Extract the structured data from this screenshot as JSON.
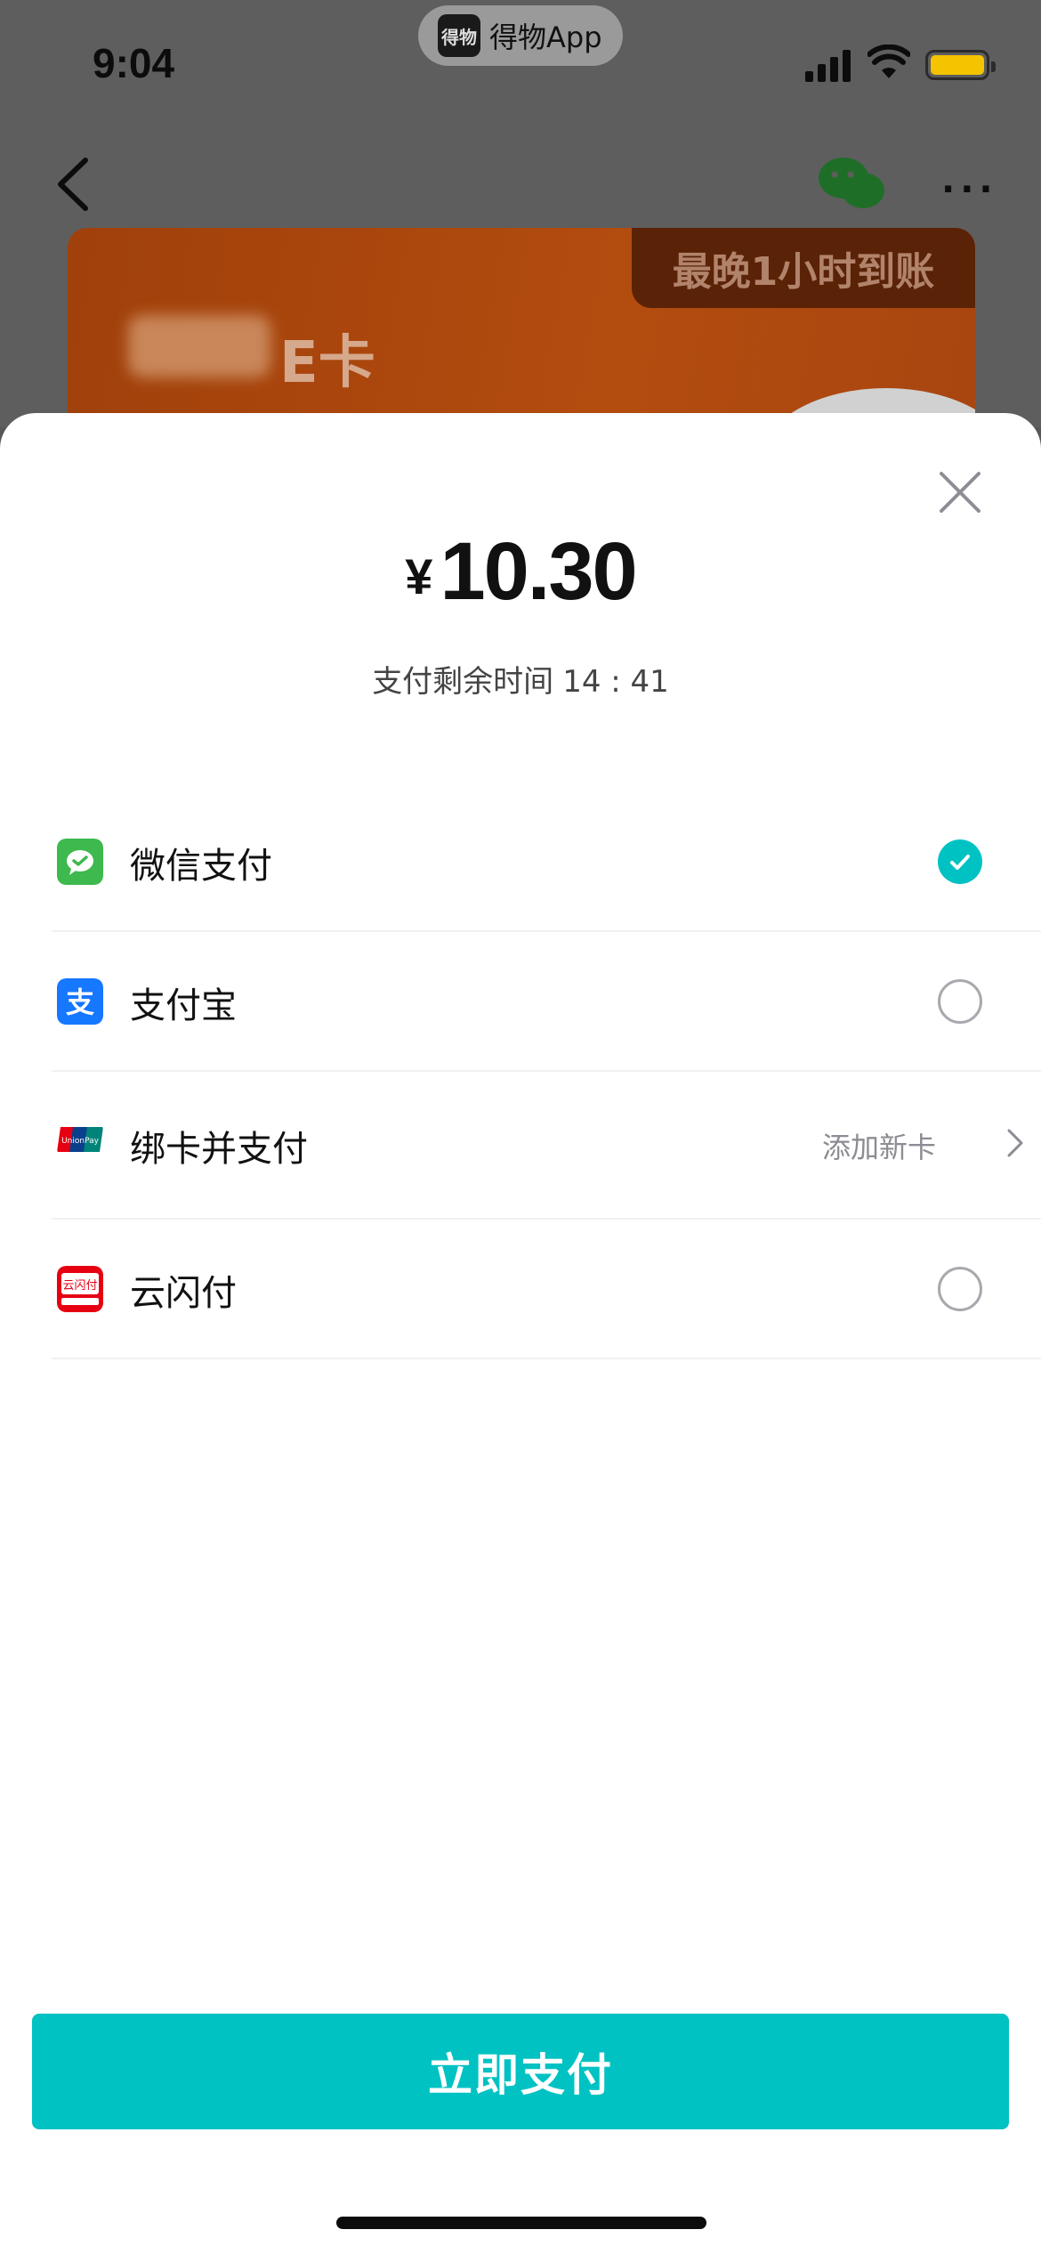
{
  "status_bar": {
    "time": "9:04",
    "island_logo_text": "得物",
    "island_app_name": "得物App"
  },
  "background_page": {
    "ecard_tag": "最晚1小时到账",
    "ecard_title": "E卡"
  },
  "payment": {
    "currency_symbol": "¥",
    "amount": "10.30",
    "countdown_label": "支付剩余时间",
    "countdown_value": "14 : 41"
  },
  "methods": [
    {
      "label": "微信支付",
      "icon": "wechat-pay-icon",
      "selected": true
    },
    {
      "label": "支付宝",
      "icon": "alipay-icon",
      "selected": false
    },
    {
      "label": "绑卡并支付",
      "icon": "unionpay-icon",
      "action_label": "添加新卡"
    },
    {
      "label": "云闪付",
      "icon": "quickpass-icon",
      "selected": false
    }
  ],
  "pay_button_label": "立即支付",
  "colors": {
    "accent": "#01C2C3",
    "wechat_green": "#3DB94D",
    "alipay_blue": "#1677FF",
    "unionpay_red": "#E60012"
  }
}
